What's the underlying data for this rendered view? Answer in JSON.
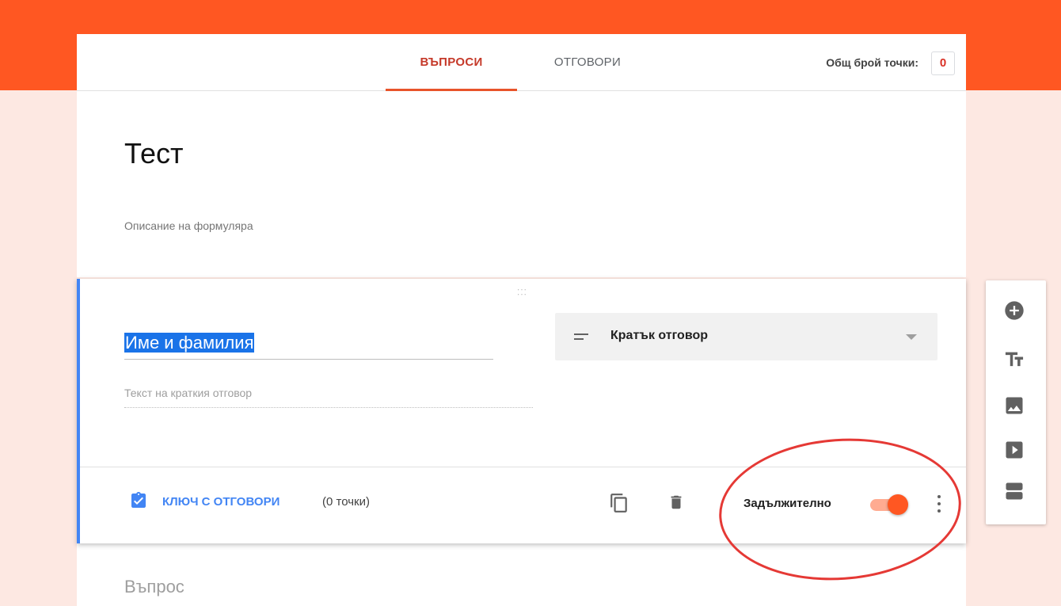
{
  "header": {
    "tabs": [
      {
        "label": "ВЪПРОСИ",
        "active": true
      },
      {
        "label": "ОТГОВОРИ",
        "active": false
      }
    ],
    "points_label": "Общ брой точки:",
    "points_value": "0"
  },
  "form": {
    "title": "Тест",
    "description_placeholder": "Описание на формуляра"
  },
  "question": {
    "title": "Име и фамилия",
    "type_label": "Кратък отговор",
    "answer_placeholder": "Текст на краткия отговор",
    "answer_key_label": "КЛЮЧ С ОТГОВОРИ",
    "points_text": "(0 точки)",
    "required_label": "Задължително",
    "required_on": true
  },
  "next_question": {
    "title_placeholder": "Въпрос"
  },
  "toolbar": {
    "buttons": [
      "add-question-icon",
      "add-title-icon",
      "add-image-icon",
      "add-video-icon",
      "add-section-icon"
    ]
  },
  "colors": {
    "brand": "#ff5722",
    "accent_blue": "#4285f4",
    "active_tab": "#c53929",
    "annotation": "#e53935"
  }
}
